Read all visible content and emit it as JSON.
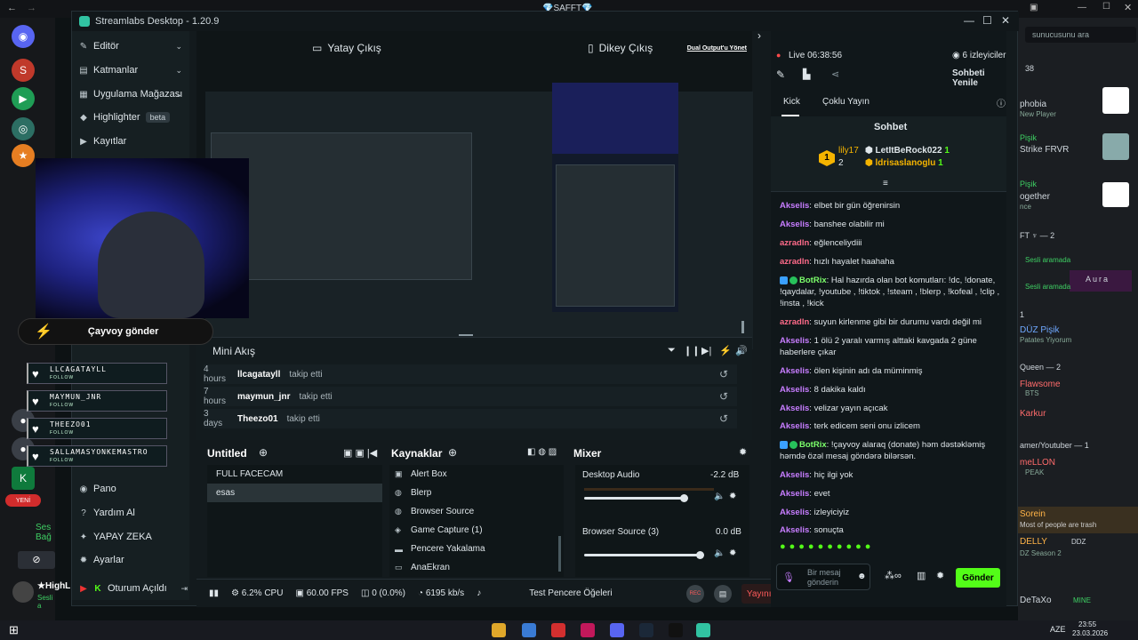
{
  "browser": {
    "title": "💎SAFFT💎"
  },
  "app": {
    "title": "Streamlabs Desktop - 1.20.9"
  },
  "nav": {
    "items": [
      {
        "label": "Editör",
        "icon": "brush-icon"
      },
      {
        "label": "Katmanlar",
        "icon": "layers-icon"
      },
      {
        "label": "Uygulama Mağazası",
        "icon": "store-icon"
      },
      {
        "label": "Highlighter",
        "icon": "highlighter-icon"
      },
      {
        "label": "Kayıtlar",
        "icon": "record-icon"
      }
    ],
    "beta": "beta",
    "bottom": [
      {
        "label": "Pano"
      },
      {
        "label": "Yardım Al"
      },
      {
        "label": "YAPAY ZEKA"
      },
      {
        "label": "Ayarlar"
      },
      {
        "label": "Oturum Açıldı"
      }
    ]
  },
  "editor": {
    "horizontal": "Yatay Çıkış",
    "vertical": "Dikey Çıkış",
    "dual": "Dual Output'u Yönet"
  },
  "overlay": {
    "button": "Çayvoy gönder",
    "follows": [
      "LLCAGATAYLL",
      "MAYMUN_JNR",
      "THEEZO01",
      "SALLAMASYONKEMASTRO"
    ],
    "follow_tag": "FOLLOW"
  },
  "mini": {
    "title": "Mini Akış",
    "rows": [
      {
        "time": "4 hours",
        "user": "llcagatayll",
        "action": "takip etti"
      },
      {
        "time": "7 hours",
        "user": "maymun_jnr",
        "action": "takip etti"
      },
      {
        "time": "3 days",
        "user": "Theezo01",
        "action": "takip etti"
      }
    ]
  },
  "scenes": {
    "title": "Untitled",
    "items": [
      "FULL FACECAM",
      "esas"
    ]
  },
  "sources": {
    "title": "Kaynaklar",
    "items": [
      "Alert Box",
      "Blerp",
      "Browser Source",
      "Game Capture (1)",
      "Pencere Yakalama",
      "AnaEkran"
    ]
  },
  "mixer": {
    "title": "Mixer",
    "channels": [
      {
        "name": "Desktop Audio",
        "db": "-2.2 dB",
        "level": 0.86
      },
      {
        "name": "Browser Source (3)",
        "db": "0.0 dB",
        "level": 1.0
      }
    ]
  },
  "status": {
    "cpu": "6.2% CPU",
    "fps": "60.00 FPS",
    "dropped": "0 (0.0%)",
    "bitrate": "6195 kb/s",
    "test": "Test Pencere Öğeleri",
    "rec": "REC",
    "end": "Yayını Sonlandır"
  },
  "chat": {
    "live": "Live 06:38:56",
    "viewers": "6 izleyiciler",
    "refresh": "Sohbeti Yenile",
    "tabs": [
      "Kick",
      "Çoklu Yayın"
    ],
    "header": "Sohbet",
    "leader": {
      "top": {
        "rank": "1",
        "name": "lily17",
        "count": "1"
      },
      "second": {
        "rank": "2",
        "count": "1"
      },
      "a": {
        "name": "LetItBeRock022",
        "count": "1"
      },
      "b": {
        "name": "ldrisaslanoglu",
        "count": "1"
      }
    },
    "messages": [
      {
        "user": "Akselis",
        "text": "elbet bir gün öğrenirsin",
        "type": "ak"
      },
      {
        "user": "Akselis",
        "text": "banshee olabilir mi",
        "type": "ak"
      },
      {
        "user": "azradln",
        "text": "eğlenceliydiii",
        "type": "az"
      },
      {
        "user": "azradln",
        "text": "hızlı hayalet haahaha",
        "type": "az"
      },
      {
        "user": "BotRix",
        "text": "Hal hazırda olan bot komutları: !dc, !donate, !qaydalar, !youtube , !tiktok , !steam , !blerp , !kofeal , !clip , !insta , !kick",
        "type": "bot"
      },
      {
        "user": "azradln",
        "text": "suyun kirlenme gibi bir durumu vardı değil mi",
        "type": "az"
      },
      {
        "user": "Akselis",
        "text": "1 ölü 2 yaralı varmış alttaki kavgada 2 güne haberlere çıkar",
        "type": "ak"
      },
      {
        "user": "Akselis",
        "text": "ölen kişinin adı da müminmiş",
        "type": "ak"
      },
      {
        "user": "Akselis",
        "text": "8 dakika kaldı",
        "type": "ak"
      },
      {
        "user": "Akselis",
        "text": "velizar yayın açıcak",
        "type": "ak"
      },
      {
        "user": "Akselis",
        "text": "terk edicem seni onu izlicem",
        "type": "ak"
      },
      {
        "user": "BotRix",
        "text": "!çayvoy alaraq (donate) həm dəstəkləmiş həmdə özəl mesaj göndərə bilərsən.",
        "type": "bot"
      },
      {
        "user": "Akselis",
        "text": "hiç ilgi yok",
        "type": "ak"
      },
      {
        "user": "Akselis",
        "text": "evet",
        "type": "ak"
      },
      {
        "user": "Akselis",
        "text": "izleyiciyiz",
        "type": "ak"
      },
      {
        "user": "Akselis",
        "text": "sonuçta",
        "type": "ak"
      }
    ],
    "input_placeholder": "Bir mesaj gönderin",
    "send": "Gönder"
  },
  "discord_right": {
    "search": "sunucusunu ara",
    "count": "38",
    "rows": [
      "phobia",
      "New Player",
      "Pişik",
      "Strike FRVR",
      "Pişik",
      "ogether",
      "nce",
      "FT ♆ — 2",
      "Sesli aramada",
      "Aura",
      "1",
      "DÜZ Pişik",
      "Patates Yiyorum",
      "Queen — 2",
      "Flawsome",
      "BTS",
      "Karkur",
      "amer/Youtuber — 1",
      "meLLON",
      "PEAK",
      "Sorein",
      "Most of people are trash",
      "DELLY",
      "DDZ",
      "DZ Season 2",
      "DeTaXo",
      "MINE"
    ]
  },
  "discord_left": {
    "bottom_label": "Ses Bağ",
    "user": "★HighL",
    "user_status": "Sesli a",
    "yeni": "YENİ"
  },
  "taskbar": {
    "lang": "AZE",
    "time": "23:55",
    "date": "23.03.2026"
  }
}
